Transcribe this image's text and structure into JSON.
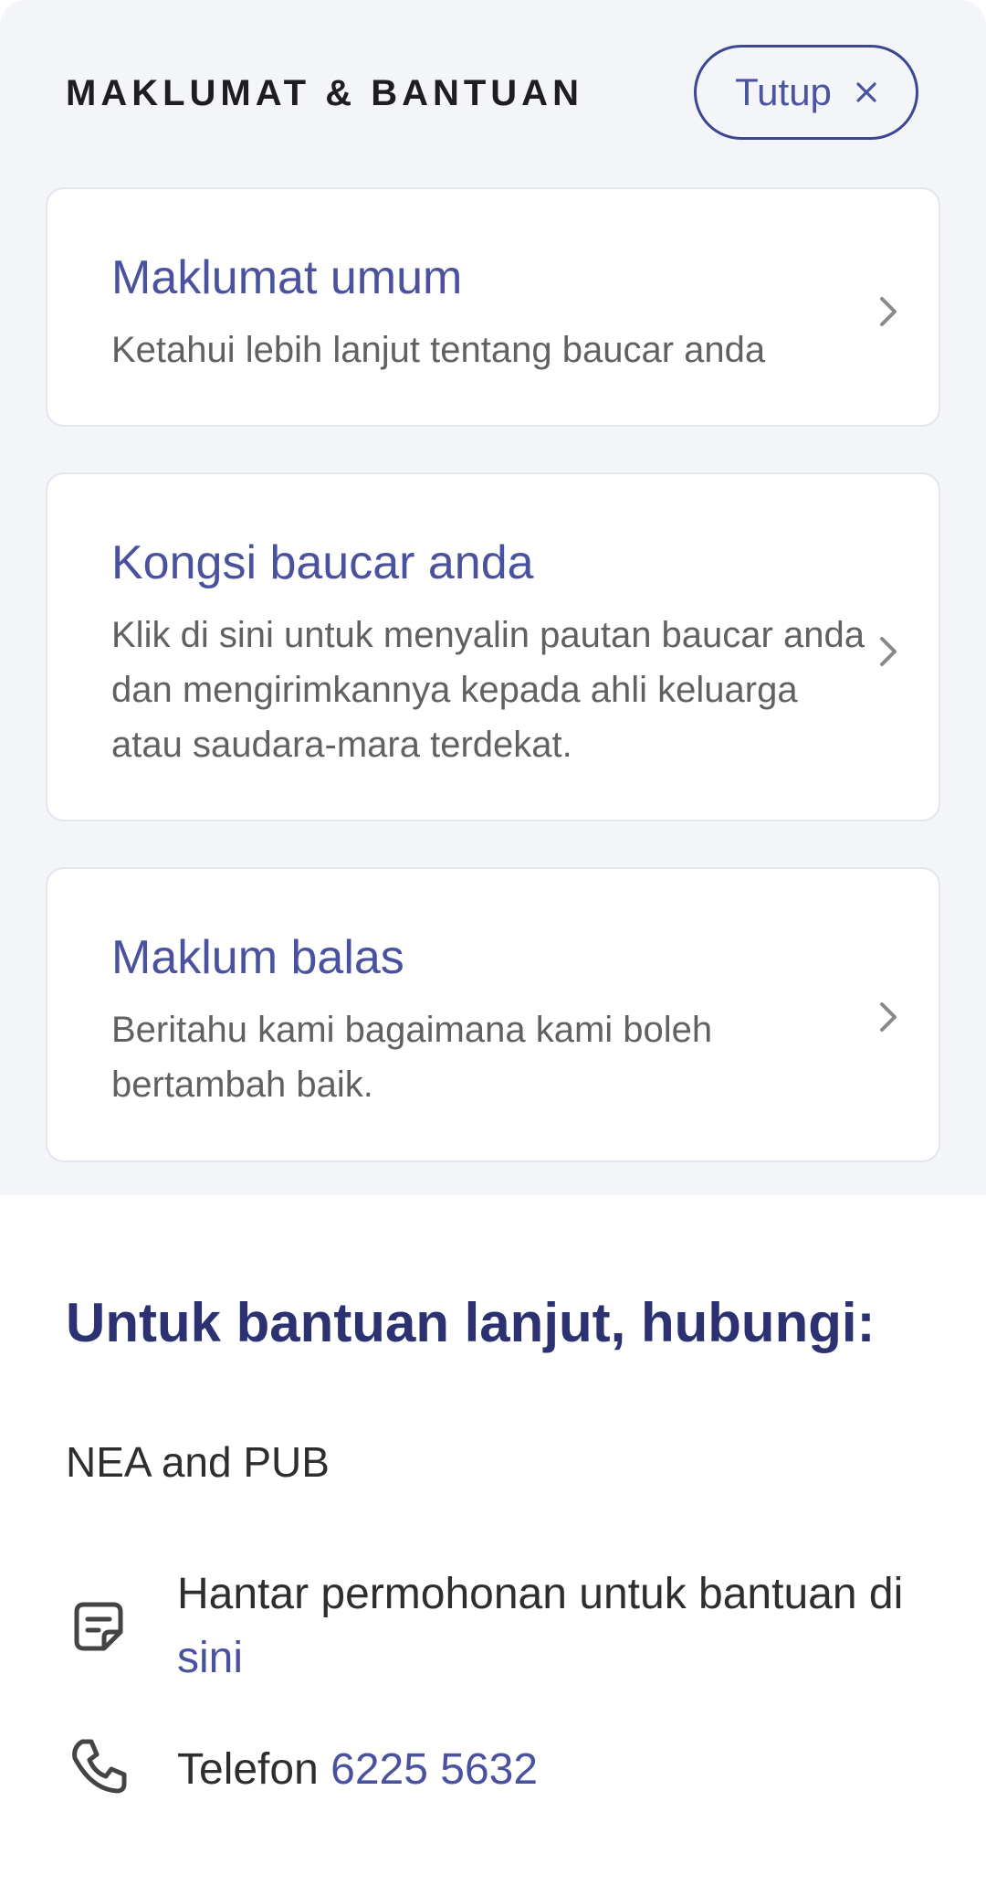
{
  "header": {
    "title": "MAKLUMAT & BANTUAN",
    "close_label": "Tutup"
  },
  "cards": [
    {
      "title": "Maklumat umum",
      "description": "Ketahui lebih lanjut tentang baucar anda"
    },
    {
      "title": "Kongsi baucar anda",
      "description": "Klik di sini untuk menyalin pautan baucar anda dan mengirimkannya kepada ahli keluarga atau saudara-mara terdekat."
    },
    {
      "title": "Maklum balas",
      "description": "Beritahu kami bagaimana kami boleh bertambah baik."
    }
  ],
  "help": {
    "heading": "Untuk bantuan lanjut, hubungi:",
    "organization": "NEA and PUB",
    "request_text": "Hantar permohonan untuk bantuan di",
    "request_link": "sini",
    "phone_prefix": "Telefon",
    "phone_number": "6225 5632"
  },
  "colors": {
    "accent": "#4a52a0",
    "heading": "#2c3271",
    "panel_background": "#f4f5f9"
  },
  "icons": {
    "close": "close-icon",
    "chevron": "chevron-right-icon",
    "request": "document-form-icon",
    "phone": "phone-icon"
  }
}
